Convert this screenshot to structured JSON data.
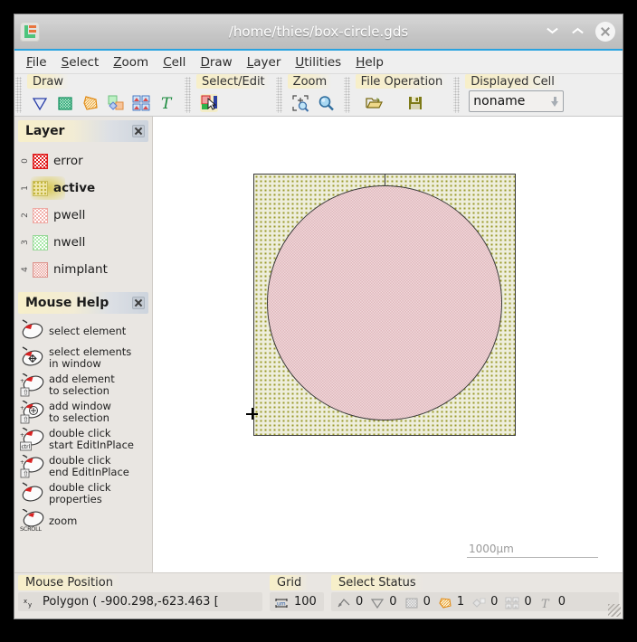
{
  "window": {
    "title": "/home/thies/box-circle.gds",
    "app_icon": "layout-editor-icon",
    "minimize_label": "chevron-down-icon",
    "maximize_label": "chevron-up-icon",
    "close_label": "close-icon"
  },
  "menubar": {
    "items": [
      {
        "label": "File",
        "mnemonic": "F"
      },
      {
        "label": "Select",
        "mnemonic": "S"
      },
      {
        "label": "Zoom",
        "mnemonic": "Z"
      },
      {
        "label": "Cell",
        "mnemonic": "C"
      },
      {
        "label": "Draw",
        "mnemonic": "D"
      },
      {
        "label": "Layer",
        "mnemonic": "L"
      },
      {
        "label": "Utilities",
        "mnemonic": "U"
      },
      {
        "label": "Help",
        "mnemonic": "H"
      }
    ]
  },
  "toolbars": [
    {
      "title": "Draw",
      "icons": [
        "draw-polygon-icon",
        "draw-box-icon",
        "draw-path-icon",
        "draw-cell-reference-icon",
        "draw-array-icon",
        "draw-text-icon"
      ]
    },
    {
      "title": "Select/Edit",
      "icons": [
        "select-edit-icon"
      ]
    },
    {
      "title": "Zoom",
      "icons": [
        "zoom-fit-icon",
        "zoom-magnifier-icon"
      ]
    },
    {
      "title": "File Operation",
      "icons": [
        "open-folder-icon",
        "save-floppy-icon"
      ]
    },
    {
      "title": "Displayed Cell",
      "combo": {
        "value": "noname",
        "arrow": "chevron-down-icon"
      }
    }
  ],
  "layer_panel": {
    "title": "Layer",
    "close_icon": "panel-close-icon",
    "items": [
      {
        "index": "0",
        "name": "error",
        "swatch": "sw-error",
        "active": false
      },
      {
        "index": "1",
        "name": "active",
        "swatch": "sw-active",
        "active": true
      },
      {
        "index": "2",
        "name": "pwell",
        "swatch": "sw-pwell",
        "active": false
      },
      {
        "index": "3",
        "name": "nwell",
        "swatch": "sw-nwell",
        "active": false
      },
      {
        "index": "4",
        "name": "nimplant",
        "swatch": "sw-nimplant",
        "active": false
      }
    ]
  },
  "mouse_help_panel": {
    "title": "Mouse Help",
    "close_icon": "panel-close-icon",
    "items": [
      {
        "icon": "mouse-left-click-icon",
        "text": "select element"
      },
      {
        "icon": "mouse-left-drag-window-icon",
        "text": "select elements\nin window"
      },
      {
        "icon": "mouse-shift-left-click-icon",
        "text": "add element\nto selection"
      },
      {
        "icon": "mouse-shift-left-drag-icon",
        "text": "add window\nto selection"
      },
      {
        "icon": "mouse-ctrl-double-click-icon",
        "text": "double click\nstart EditInPlace"
      },
      {
        "icon": "mouse-shift-double-click-icon",
        "text": "double click\nend EditInPlace"
      },
      {
        "icon": "mouse-double-click-icon",
        "text": "double click\nproperties"
      },
      {
        "icon": "mouse-scroll-icon",
        "text": "zoom"
      }
    ]
  },
  "canvas": {
    "scale_label": "1000µm",
    "shapes": [
      {
        "name": "box-shape",
        "layer": "active",
        "kind": "rectangle"
      },
      {
        "name": "circle-shape",
        "layer": "nimplant",
        "kind": "circle"
      }
    ],
    "cursor": "crosshair-cursor"
  },
  "statusbar": {
    "mouse_position": {
      "title": "Mouse Position",
      "icon": "xy-coordinate-icon",
      "value": "Polygon  ( -900.298,-623.463 ["
    },
    "grid": {
      "title": "Grid",
      "icon": "grid-ruler-icon",
      "value": "100"
    },
    "select_status": {
      "title": "Select Status",
      "counts": [
        {
          "icon": "path-icon",
          "value": "0"
        },
        {
          "icon": "polygon-icon",
          "value": "0"
        },
        {
          "icon": "box-icon",
          "value": "0"
        },
        {
          "icon": "circle-icon",
          "value": "1"
        },
        {
          "icon": "reference-icon",
          "value": "0"
        },
        {
          "icon": "array-icon",
          "value": "0"
        },
        {
          "icon": "text-icon",
          "value": "0"
        }
      ]
    },
    "resize_grip": "resize-grip-icon"
  },
  "colors": {
    "accent": "#2aa3e0",
    "title_gradient_top": "#d8d8d8",
    "active_layer": "#c3b53c",
    "nimplant_layer": "#e0b9bd",
    "error_layer": "#e01b1b",
    "nwell_layer": "#a9e8a9",
    "pwell_layer": "#f2b0ab"
  }
}
